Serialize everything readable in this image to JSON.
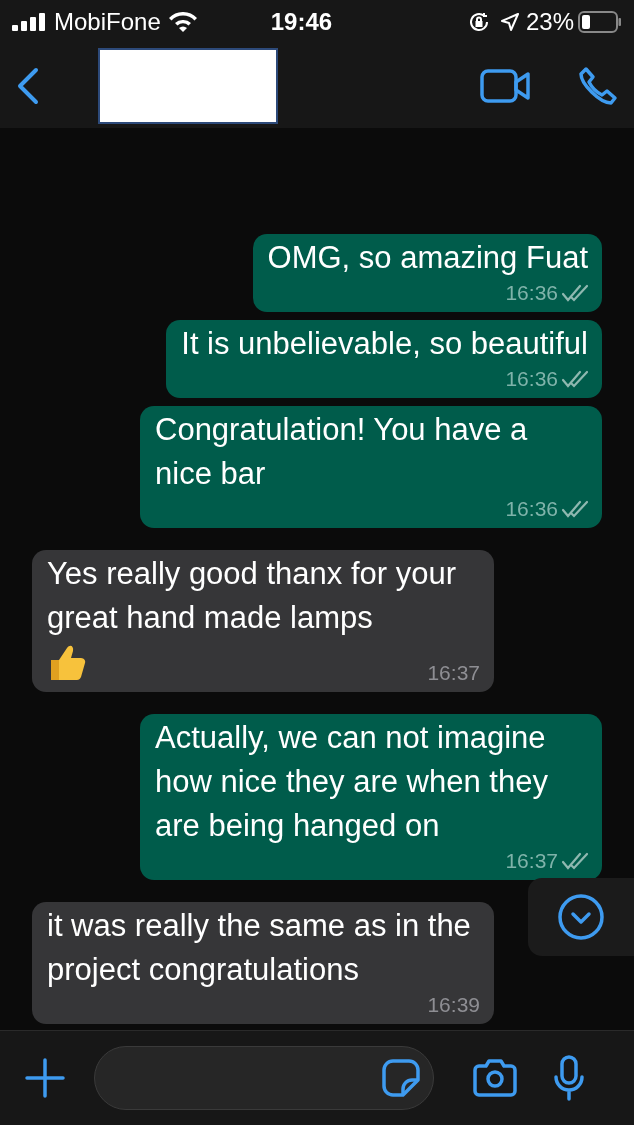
{
  "status_bar": {
    "carrier": "MobiFone",
    "time": "19:46",
    "battery": "23%"
  },
  "messages": [
    {
      "kind": "out",
      "text": "OMG, so amazing Fuat",
      "time": "16:36",
      "delivered": true
    },
    {
      "kind": "out",
      "text": "It is unbelievable, so beautiful",
      "time": "16:36",
      "delivered": true
    },
    {
      "kind": "out",
      "text": "Congratulation! You have a nice bar",
      "time": "16:36",
      "delivered": true
    },
    {
      "kind": "in",
      "text": "Yes really good thanx for your great hand made lamps",
      "time": "16:37",
      "thumbs_up": true
    },
    {
      "kind": "out",
      "text": "Actually, we can not imagine how nice they are when they are being hanged on",
      "time": "16:37",
      "delivered": true
    },
    {
      "kind": "in",
      "text": "it was really the same as in the project congratulations",
      "time": "16:39"
    }
  ]
}
